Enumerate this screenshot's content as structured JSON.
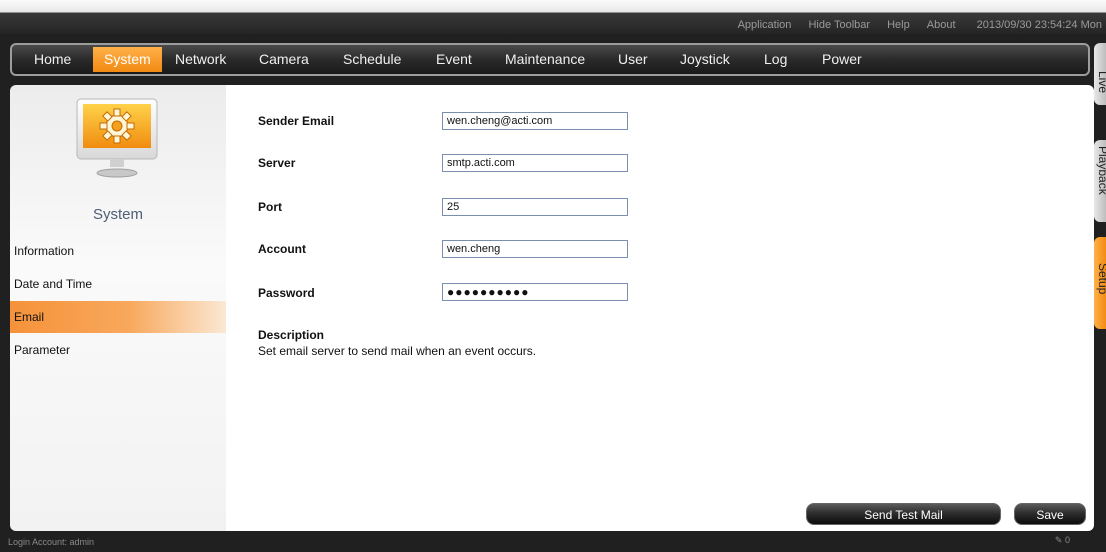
{
  "top_links": {
    "application": "Application",
    "hide_toolbar": "Hide Toolbar",
    "help": "Help",
    "about": "About",
    "datetime": "2013/09/30 23:54:24 Mon"
  },
  "nav": {
    "home": "Home",
    "system": "System",
    "network": "Network",
    "camera": "Camera",
    "schedule": "Schedule",
    "event": "Event",
    "maintenance": "Maintenance",
    "user": "User",
    "joystick": "Joystick",
    "log": "Log",
    "power": "Power",
    "active": "System"
  },
  "sidebar": {
    "icon": "gear-monitor-icon",
    "title": "System",
    "items": [
      {
        "label": "Information"
      },
      {
        "label": "Date and Time"
      },
      {
        "label": "Email"
      },
      {
        "label": "Parameter"
      }
    ],
    "active": "Email"
  },
  "form": {
    "sender_email_label": "Sender Email",
    "sender_email_value": "wen.cheng@acti.com",
    "server_label": "Server",
    "server_value": "smtp.acti.com",
    "port_label": "Port",
    "port_value": "25",
    "account_label": "Account",
    "account_value": "wen.cheng",
    "password_label": "Password",
    "password_value": "●●●●●●●●●●"
  },
  "description": {
    "title": "Description",
    "text": "Set email server to send mail when an event occurs."
  },
  "buttons": {
    "send_test_mail": "Send Test Mail",
    "save": "Save"
  },
  "side_tabs": {
    "live": "Live",
    "playback": "Playback",
    "setup": "Setup",
    "active": "Setup"
  },
  "status": {
    "login": "Login Account: admin",
    "right_count": "0",
    "right_icon": "megaphone-icon"
  },
  "colors": {
    "accent": "#f28a12",
    "input_border": "#7a8fae"
  }
}
